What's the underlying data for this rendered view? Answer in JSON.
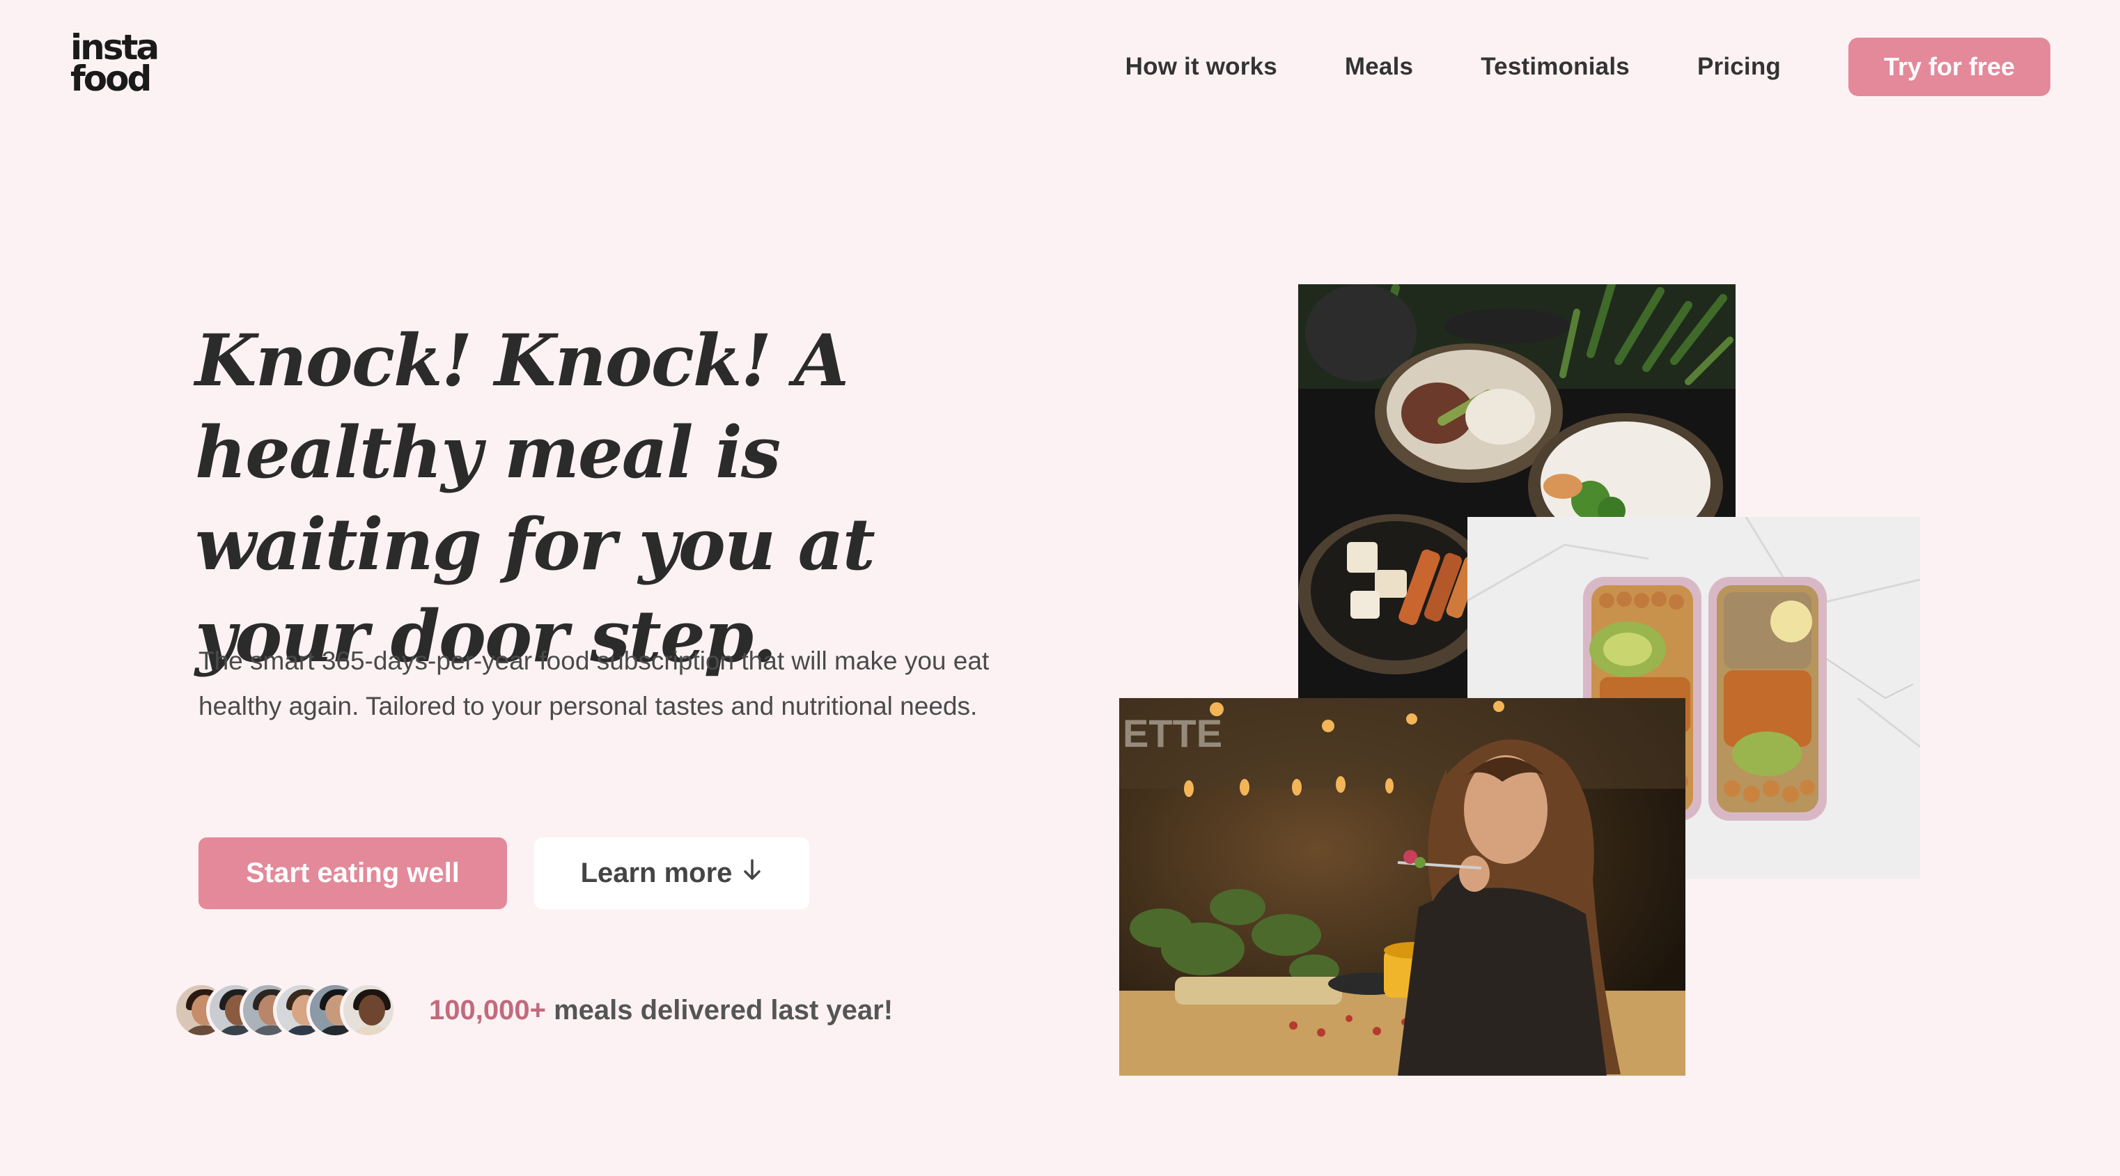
{
  "brand": {
    "logo_line1": "insta",
    "logo_line2": "food"
  },
  "nav": {
    "links": [
      "How it works",
      "Meals",
      "Testimonials",
      "Pricing"
    ],
    "cta": "Try for free"
  },
  "hero": {
    "headline": "Knock! Knock! A healthy meal is waiting for you at your door step.",
    "description": "The smart 365-days-per-year food subscription that will make you eat healthy again. Tailored to your personal tastes and nutritional needs.",
    "primary_button": "Start eating well",
    "secondary_button": "Learn more",
    "secondary_icon": "arrow-down-icon",
    "social_proof": {
      "count": "100,000+",
      "text": "meals delivered last year!"
    }
  },
  "images": [
    {
      "name": "bowls-with-steak-and-rice-photo"
    },
    {
      "name": "meal-prep-containers-photo"
    },
    {
      "name": "woman-eating-in-restaurant-photo"
    }
  ],
  "colors": {
    "accent": "#e3899a",
    "background": "#fcf2f4",
    "accent_text": "#c26a7d"
  }
}
